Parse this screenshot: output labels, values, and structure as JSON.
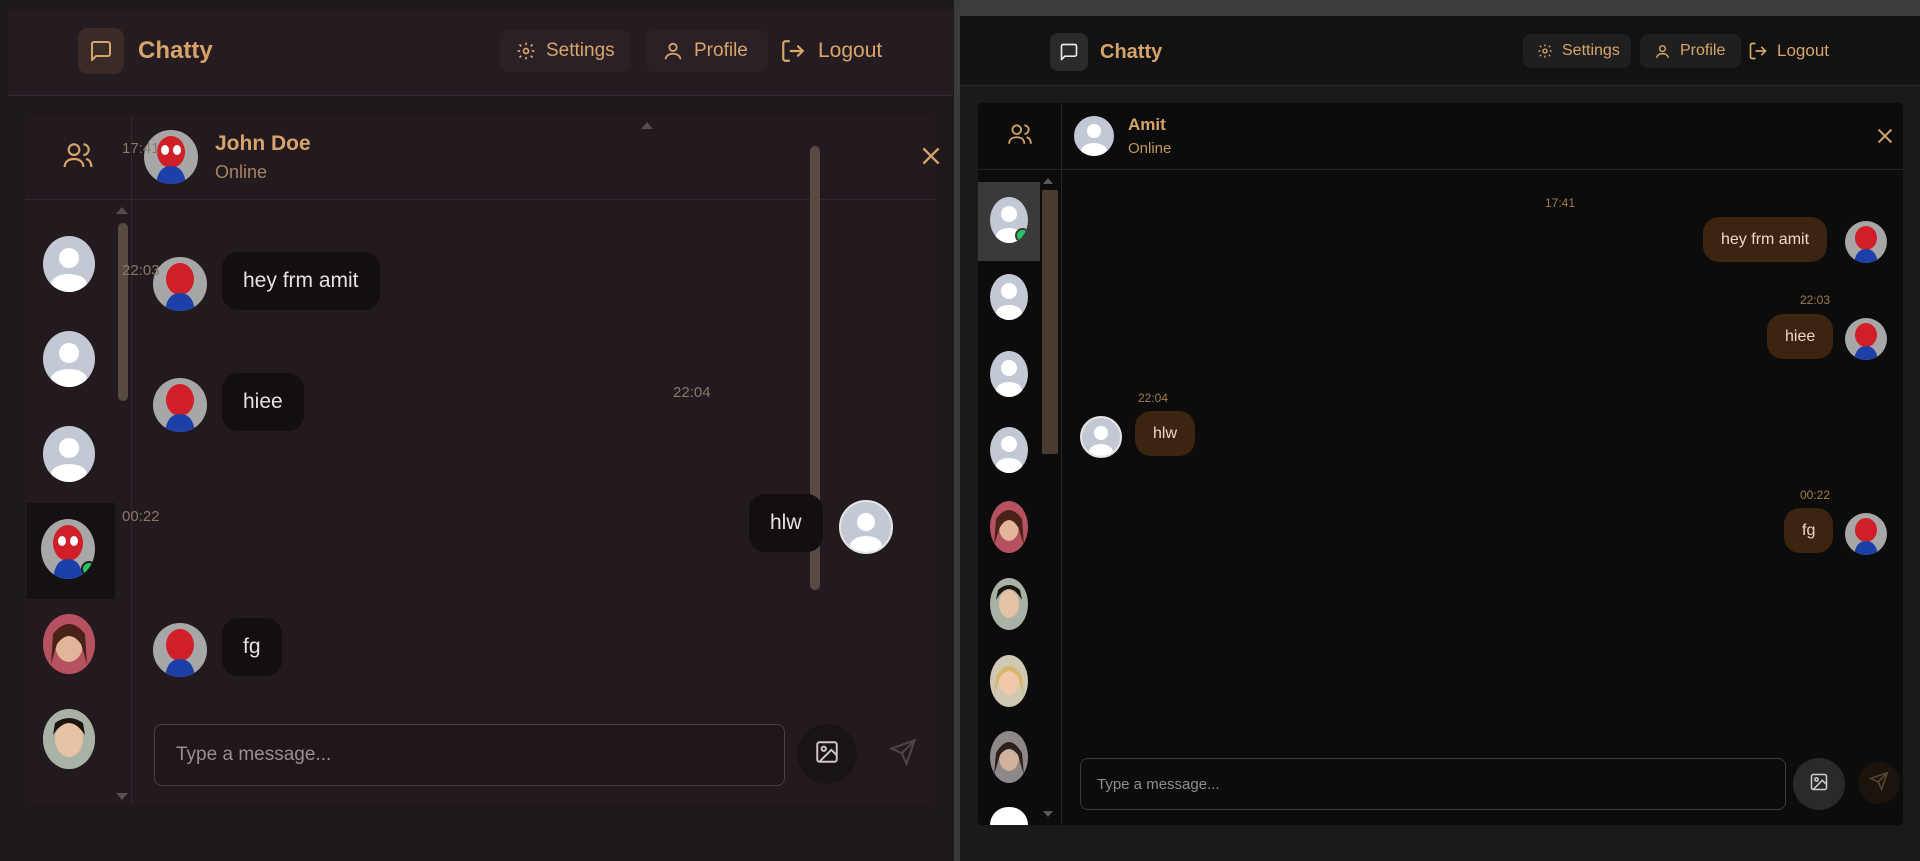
{
  "app": {
    "name": "Chatty"
  },
  "nav": {
    "settings": "Settings",
    "profile": "Profile",
    "logout": "Logout"
  },
  "left": {
    "contact": {
      "name": "John Doe",
      "status": "Online"
    },
    "messages": [
      {
        "time": "17:41",
        "text": "hey frm amit",
        "side": "in"
      },
      {
        "time": "22:03",
        "text": "hiee",
        "side": "in"
      },
      {
        "time": "22:04",
        "text": "hlw",
        "side": "out"
      },
      {
        "time": "00:22",
        "text": "fg",
        "side": "in"
      }
    ],
    "input_placeholder": "Type a message..."
  },
  "right": {
    "contact": {
      "name": "Amit",
      "status": "Online"
    },
    "messages": [
      {
        "time": "17:41",
        "text": "hey frm amit",
        "side": "out"
      },
      {
        "time": "22:03",
        "text": "hiee",
        "side": "out"
      },
      {
        "time": "22:04",
        "text": "hlw",
        "side": "in"
      },
      {
        "time": "00:22",
        "text": "fg",
        "side": "out"
      }
    ],
    "input_placeholder": "Type a message..."
  },
  "colors": {
    "accent": "#d6a36a",
    "online": "#22c55e",
    "left_bg": "#1f181d",
    "right_bg": "#0c0c0c"
  }
}
